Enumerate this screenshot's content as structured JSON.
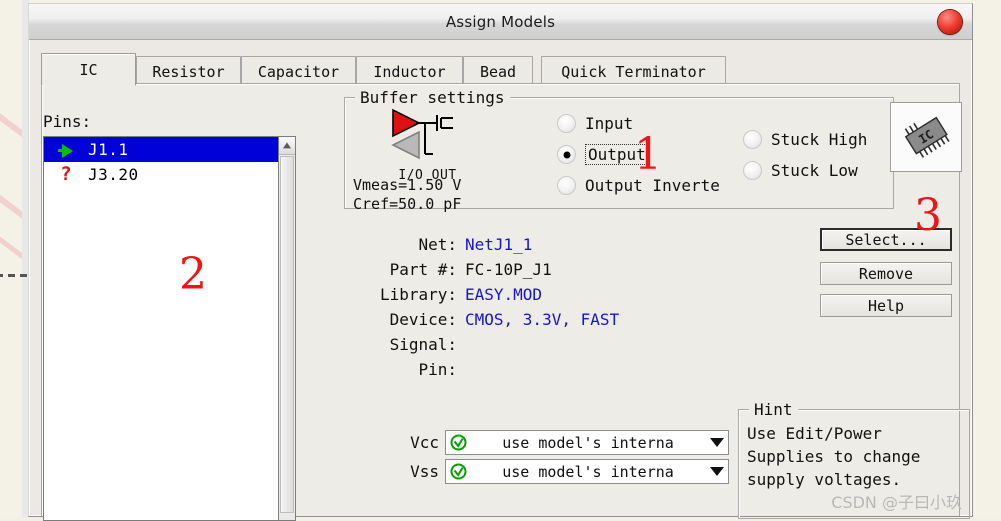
{
  "window": {
    "title": "Assign Models",
    "close_icon": "close-circle-icon"
  },
  "tabs": [
    {
      "label": "IC",
      "active": true
    },
    {
      "label": "Resistor",
      "active": false
    },
    {
      "label": "Capacitor",
      "active": false
    },
    {
      "label": "Inductor",
      "active": false
    },
    {
      "label": "Bead",
      "active": false
    },
    {
      "label": "Quick Terminator",
      "active": false
    }
  ],
  "pins": {
    "label": "Pins:",
    "items": [
      {
        "icon": "green-output-arrow-icon",
        "name": "J1.1",
        "selected": true
      },
      {
        "icon": "red-question-mark-icon",
        "name": "J3.20",
        "selected": false
      }
    ]
  },
  "buffer": {
    "legend": "Buffer settings",
    "icon_caption": "I/O OUT",
    "vmeas": "Vmeas=1.50 V",
    "cref": "Cref=50.0 pF",
    "options_left": [
      {
        "label": "Input",
        "selected": false,
        "focused": false
      },
      {
        "label": "Output",
        "selected": true,
        "focused": true
      },
      {
        "label": "Output Inverte",
        "selected": false,
        "focused": false
      }
    ],
    "options_right": [
      {
        "label": "Stuck High",
        "selected": false
      },
      {
        "label": "Stuck Low",
        "selected": false
      }
    ]
  },
  "ic_thumbnail": {
    "icon": "ic-chip-icon",
    "label": "IC"
  },
  "details": [
    {
      "key": "Net:",
      "value": "NetJ1_1",
      "link": true
    },
    {
      "key": "Part #:",
      "value": "FC-10P_J1",
      "link": false
    },
    {
      "key": "Library:",
      "value": "EASY.MOD",
      "link": true
    },
    {
      "key": "Device:",
      "value": "CMOS, 3.3V, FAST",
      "link": true
    },
    {
      "key": "Signal:",
      "value": "",
      "link": false
    },
    {
      "key": "Pin:",
      "value": "",
      "link": false
    }
  ],
  "buttons": [
    {
      "label": "Select...",
      "default": true
    },
    {
      "label": "Remove",
      "default": false
    },
    {
      "label": "Help",
      "default": false
    }
  ],
  "supplies": [
    {
      "key": "Vcc",
      "icon": "green-check-circle-icon",
      "value": "use model's interna"
    },
    {
      "key": "Vss",
      "icon": "green-check-circle-icon",
      "value": "use model's interna"
    }
  ],
  "hint": {
    "legend": "Hint",
    "text": "Use Edit/Power\nSupplies to change\nsupply voltages."
  },
  "annotations": [
    {
      "text": "1"
    },
    {
      "text": "2"
    },
    {
      "text": "3"
    }
  ],
  "watermark": "CSDN @子曰小玖",
  "colors": {
    "selection": "#0000d8",
    "link": "#1515d2",
    "annotation": "#f01414",
    "ok_green": "#00a000"
  }
}
